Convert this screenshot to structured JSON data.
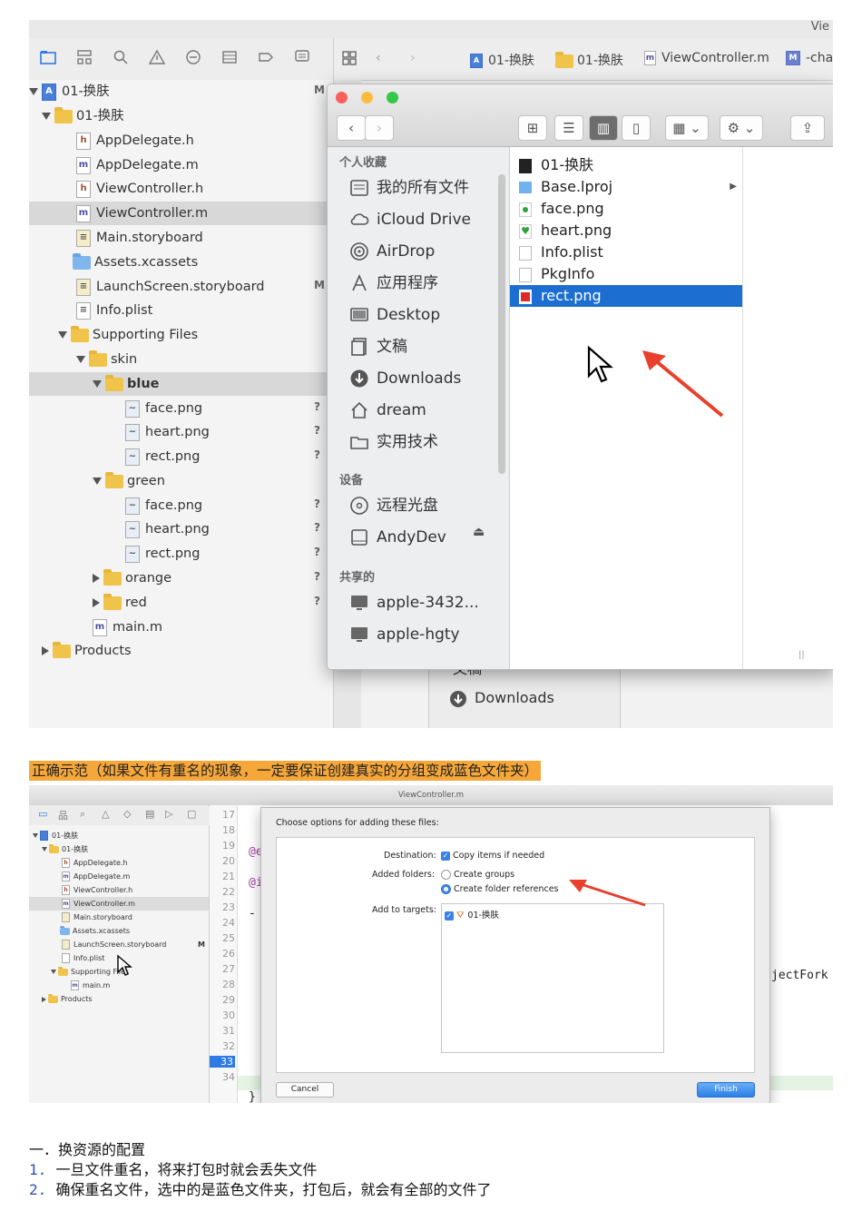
{
  "shot1": {
    "window_title_fragment": "Vie",
    "jumpbar": {
      "crumbs": [
        "01-换肤",
        "01-换肤",
        "ViewController.m",
        "-change"
      ]
    },
    "navigator": {
      "rows": [
        {
          "label": "01-换肤",
          "status": "M"
        },
        {
          "label": "01-换肤",
          "status": ""
        },
        {
          "label": "AppDelegate.h",
          "status": ""
        },
        {
          "label": "AppDelegate.m",
          "status": ""
        },
        {
          "label": "ViewController.h",
          "status": ""
        },
        {
          "label": "ViewController.m",
          "status": ""
        },
        {
          "label": "Main.storyboard",
          "status": ""
        },
        {
          "label": "Assets.xcassets",
          "status": ""
        },
        {
          "label": "LaunchScreen.storyboard",
          "status": "M"
        },
        {
          "label": "Info.plist",
          "status": ""
        },
        {
          "label": "Supporting Files",
          "status": ""
        },
        {
          "label": "skin",
          "status": ""
        },
        {
          "label": "blue",
          "status": ""
        },
        {
          "label": "face.png",
          "status": "?"
        },
        {
          "label": "heart.png",
          "status": "?"
        },
        {
          "label": "rect.png",
          "status": "?"
        },
        {
          "label": "green",
          "status": ""
        },
        {
          "label": "face.png",
          "status": "?"
        },
        {
          "label": "heart.png",
          "status": "?"
        },
        {
          "label": "rect.png",
          "status": "?"
        },
        {
          "label": "orange",
          "status": "?"
        },
        {
          "label": "red",
          "status": "?"
        },
        {
          "label": "main.m",
          "status": ""
        },
        {
          "label": "Products",
          "status": ""
        }
      ]
    },
    "finder": {
      "sidebar": {
        "favorites_header": "个人收藏",
        "favorites": [
          "我的所有文件",
          "iCloud Drive",
          "AirDrop",
          "应用程序",
          "Desktop",
          "文稿",
          "Downloads",
          "dream",
          "实用技术"
        ],
        "devices_header": "设备",
        "devices": [
          "远程光盘",
          "AndyDev"
        ],
        "shared_header": "共享的",
        "shared": [
          "apple-3432...",
          "apple-hgty"
        ]
      },
      "files": [
        "01-换肤",
        "Base.lproj",
        "face.png",
        "heart.png",
        "Info.plist",
        "PkgInfo",
        "rect.png"
      ],
      "selected_file": "rect.png"
    },
    "background_items": [
      "文稿",
      "Downloads"
    ]
  },
  "caption": "正确示范（如果文件有重名的现象，一定要保证创建真实的分组变成蓝色文件夹）",
  "shot2": {
    "window_title": "ViewController.m",
    "navigator_rows": [
      "01-换肤",
      "01-换肤",
      "AppDelegate.h",
      "AppDelegate.m",
      "ViewController.h",
      "ViewController.m",
      "Main.storyboard",
      "Assets.xcassets",
      "LaunchScreen.storyboard",
      "Info.plist",
      "Supporting Files",
      "main.m",
      "Products"
    ],
    "launch_status": "M",
    "line_numbers": [
      "17",
      "18",
      "19",
      "20",
      "21",
      "22",
      "23",
      "24",
      "25",
      "26",
      "27",
      "28",
      "29",
      "30",
      "31",
      "32",
      "33",
      "34"
    ],
    "code_fragments": {
      "l18": "@e",
      "l20": "@i",
      "l22": "-",
      "l26": "jectFork",
      "l34": "}"
    },
    "dialog": {
      "heading": "Choose options for adding these files:",
      "destination_label": "Destination:",
      "destination_option": "Copy items if needed",
      "added_folders_label": "Added folders:",
      "option_groups": "Create groups",
      "option_references": "Create folder references",
      "targets_label": "Add to targets:",
      "target_name": "01-换肤",
      "cancel": "Cancel",
      "finish": "Finish"
    }
  },
  "notes": {
    "heading": "一．换资源的配置",
    "items": [
      {
        "num": "1.",
        "text": "一旦文件重名，将来打包时就会丢失文件"
      },
      {
        "num": "2.",
        "text": "确保重名文件，选中的是蓝色文件夹，打包后，就会有全部的文件了"
      }
    ]
  },
  "colors": {
    "caption_bg": "#f6a73a",
    "selection_blue": "#1c6fd1",
    "arrow_red": "#e8402c",
    "list_number": "#2e4fb8"
  }
}
